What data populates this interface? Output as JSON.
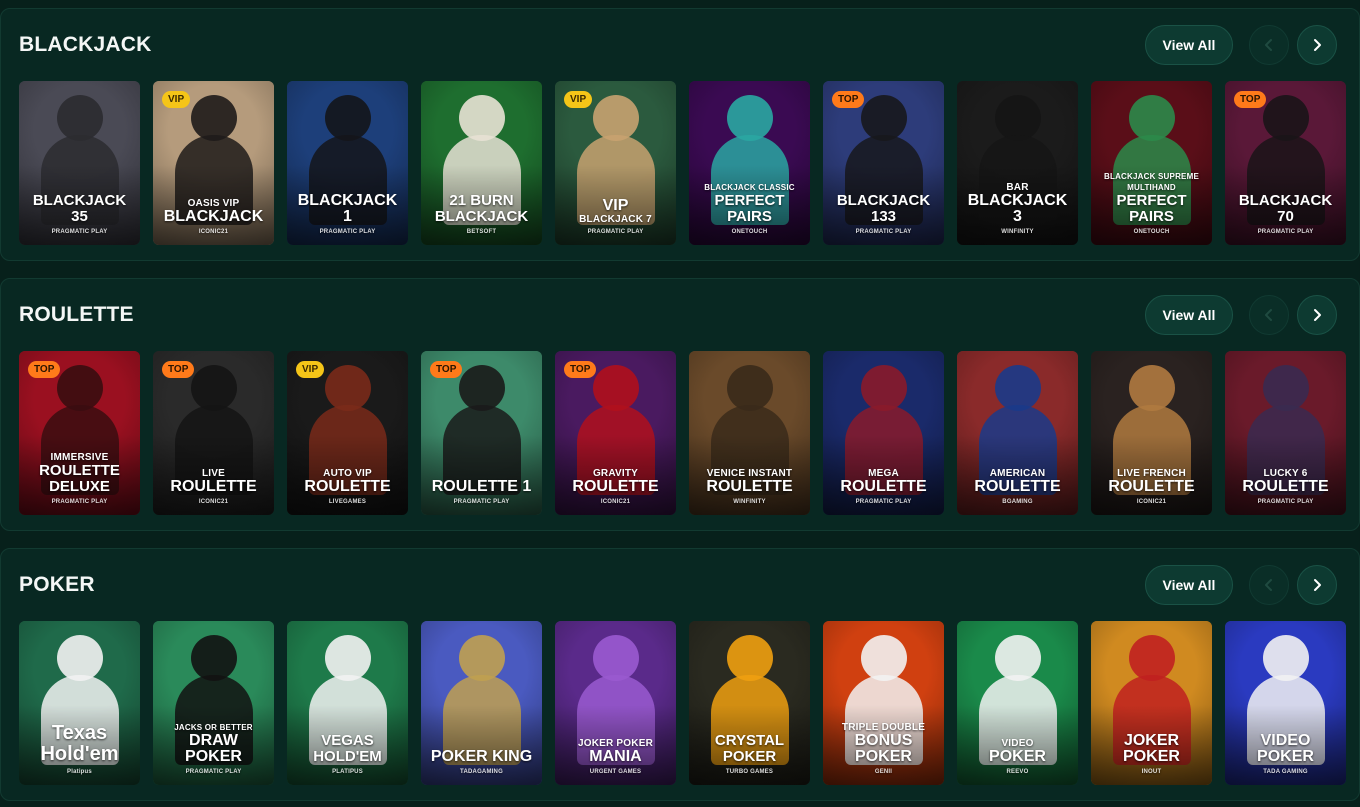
{
  "sections": [
    {
      "title": "BLACKJACK",
      "view_all": "View All",
      "cards": [
        {
          "sub": "",
          "title": "BLACKJACK 35",
          "provider": "PRAGMATIC PLAY",
          "badge": "",
          "bg": "#4a4a55",
          "accent": "#2b2b30"
        },
        {
          "sub": "OASIS VIP",
          "title": "BLACKJACK",
          "provider": "ICONIC21",
          "badge": "VIP",
          "bg": "#b59b7c",
          "accent": "#1e1b1a"
        },
        {
          "sub": "",
          "title": "BLACKJACK 1",
          "provider": "PRAGMATIC PLAY",
          "badge": "",
          "bg": "#1d3f7a",
          "accent": "#14151a"
        },
        {
          "sub": "",
          "title": "21 BURN BLACKJACK",
          "provider": "BETSOFT",
          "badge": "",
          "bg": "#1e6e2f",
          "accent": "#e8e2d5"
        },
        {
          "sub": "",
          "title": "VIP",
          "sub2": "BLACKJACK 7",
          "provider": "PRAGMATIC PLAY",
          "badge": "VIP",
          "bg": "#2b5a3e",
          "accent": "#c8a270"
        },
        {
          "sub": "BLACKJACK CLASSIC",
          "title": "PERFECT PAIRS",
          "provider": "ONETOUCH",
          "badge": "",
          "bg": "#3a0a52",
          "accent": "#2aa7a2"
        },
        {
          "sub": "",
          "title": "BLACKJACK 133",
          "provider": "PRAGMATIC PLAY",
          "badge": "TOP",
          "bg": "#2d3c7a",
          "accent": "#17171c"
        },
        {
          "sub": "BAR",
          "title": "BLACKJACK 3",
          "provider": "WINFINITY",
          "badge": "",
          "bg": "#1b1b1b",
          "accent": "#151515"
        },
        {
          "sub": "BLACKJACK SUPREME MULTIHAND",
          "title": "PERFECT PAIRS",
          "provider": "ONETOUCH",
          "badge": "",
          "bg": "#5a0e18",
          "accent": "#2b8a4a"
        },
        {
          "sub": "",
          "title": "BLACKJACK 70",
          "provider": "PRAGMATIC PLAY",
          "badge": "TOP",
          "bg": "#5a1838",
          "accent": "#1a1418"
        }
      ]
    },
    {
      "title": "ROULETTE",
      "view_all": "View All",
      "cards": [
        {
          "sub": "IMMERSIVE",
          "title": "ROULETTE DELUXE",
          "provider": "PRAGMATIC PLAY",
          "badge": "TOP",
          "bg": "#9a1020",
          "accent": "#3a0d10"
        },
        {
          "sub": "LIVE",
          "title": "ROULETTE",
          "provider": "ICONIC21",
          "badge": "TOP",
          "bg": "#2a2a2a",
          "accent": "#141414"
        },
        {
          "sub": "AUTO VIP",
          "title": "ROULETTE",
          "provider": "LIVEGAMES",
          "badge": "VIP",
          "bg": "#1a1a1a",
          "accent": "#7a2a1a"
        },
        {
          "sub": "",
          "title": "ROULETTE 1",
          "provider": "PRAGMATIC PLAY",
          "badge": "TOP",
          "bg": "#3d8a6a",
          "accent": "#1a1a1a"
        },
        {
          "sub": "GRAVITY",
          "title": "ROULETTE",
          "provider": "ICONIC21",
          "badge": "TOP",
          "bg": "#4a1a60",
          "accent": "#b0101c"
        },
        {
          "sub": "VENICE INSTANT",
          "title": "ROULETTE",
          "provider": "WINFINITY",
          "badge": "",
          "bg": "#6a4a2a",
          "accent": "#3a2a1a"
        },
        {
          "sub": "MEGA",
          "title": "ROULETTE",
          "provider": "PRAGMATIC PLAY",
          "badge": "",
          "bg": "#1a2a6a",
          "accent": "#8a1a2a"
        },
        {
          "sub": "AMERICAN",
          "title": "ROULETTE",
          "provider": "BGAMING",
          "badge": "",
          "bg": "#8a2a2a",
          "accent": "#1a3a8a"
        },
        {
          "sub": "LIVE FRENCH",
          "title": "ROULETTE",
          "provider": "ICONIC21",
          "badge": "",
          "bg": "#2a2220",
          "accent": "#b07a40"
        },
        {
          "sub": "LUCKY 6",
          "title": "ROULETTE",
          "provider": "PRAGMATIC PLAY",
          "badge": "",
          "bg": "#6a1a2a",
          "accent": "#3a2a50"
        }
      ]
    },
    {
      "title": "POKER",
      "view_all": "View All",
      "cards": [
        {
          "sub": "",
          "title": "Texas Hold'em",
          "provider": "Platipus",
          "badge": "",
          "bg": "#1f6a4a",
          "accent": "#f2f2f2"
        },
        {
          "sub": "JACKS OR BETTER",
          "title": "DRAW POKER",
          "provider": "PRAGMATIC PLAY",
          "badge": "",
          "bg": "#2a8a5a",
          "accent": "#121212"
        },
        {
          "sub": "",
          "title": "VEGAS HOLD'EM",
          "provider": "PLATIPUS",
          "badge": "",
          "bg": "#1e7a4a",
          "accent": "#f2f2f2"
        },
        {
          "sub": "",
          "title": "POKER KING",
          "provider": "TADAGAMING",
          "badge": "",
          "bg": "#4a5ac0",
          "accent": "#c0a050"
        },
        {
          "sub": "JOKER POKER",
          "title": "MANIA",
          "provider": "URGENT GAMES",
          "badge": "",
          "bg": "#5a2a8a",
          "accent": "#9a5ad0"
        },
        {
          "sub": "",
          "title": "CRYSTAL POKER",
          "provider": "TURBO GAMES",
          "badge": "",
          "bg": "#2a2a20",
          "accent": "#f0a010"
        },
        {
          "sub": "TRIPLE DOUBLE",
          "title": "BONUS POKER",
          "provider": "GENII",
          "badge": "",
          "bg": "#d04010",
          "accent": "#f2f2f2"
        },
        {
          "sub": "VIDEO",
          "title": "POKER",
          "provider": "REEVO",
          "badge": "",
          "bg": "#1a8a4a",
          "accent": "#f2f2f2"
        },
        {
          "sub": "",
          "title": "JOKER POKER",
          "provider": "INOUT",
          "badge": "",
          "bg": "#d08a20",
          "accent": "#c02020"
        },
        {
          "sub": "",
          "title": "VIDEO POKER",
          "provider": "TADA GAMING",
          "badge": "",
          "bg": "#2a3ac0",
          "accent": "#f2f2f2"
        }
      ]
    }
  ],
  "icons": {
    "prev": "chevron-left-icon",
    "next": "chevron-right-icon"
  }
}
